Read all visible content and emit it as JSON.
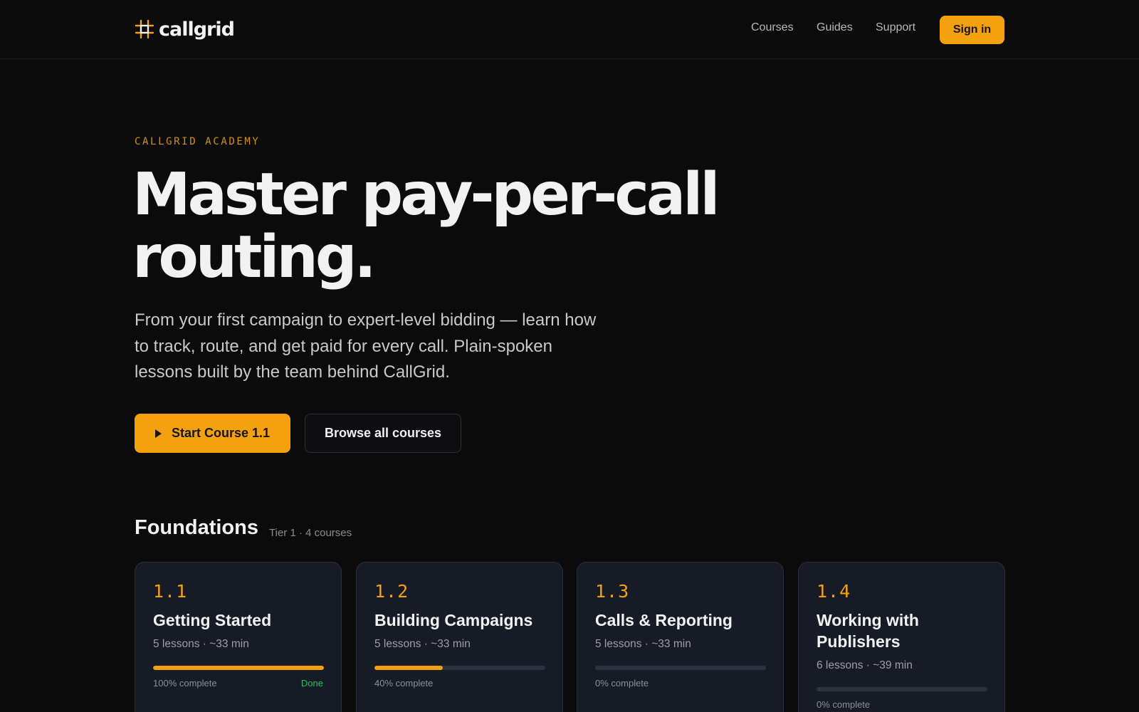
{
  "brand": {
    "name": "callgrid"
  },
  "nav": {
    "courses": "Courses",
    "guides": "Guides",
    "support": "Support",
    "signin": "Sign in"
  },
  "hero": {
    "eyebrow": "CALLGRID ACADEMY",
    "headline_line1": "Master pay-per-call",
    "headline_line2": "routing.",
    "lede": "From your first campaign to expert-level bidding — learn how to track, route, and get paid for every call. Plain-spoken lessons built by the team behind CallGrid.",
    "primary_cta": "Start Course 1.1",
    "secondary_cta": "Browse all courses"
  },
  "section": {
    "title": "Foundations",
    "meta": "Tier 1 · 4 courses"
  },
  "courses": [
    {
      "num": "1.1",
      "title": "Getting Started",
      "meta": "5 lessons · ~33 min",
      "progress": 1.0,
      "progress_label": "100% complete",
      "status": "Done"
    },
    {
      "num": "1.2",
      "title": "Building Campaigns",
      "meta": "5 lessons · ~33 min",
      "progress": 0.4,
      "progress_label": "40% complete",
      "status": ""
    },
    {
      "num": "1.3",
      "title": "Calls & Reporting",
      "meta": "5 lessons · ~33 min",
      "progress": 0.0,
      "progress_label": "0% complete",
      "status": ""
    },
    {
      "num": "1.4",
      "title": "Working with Publishers",
      "meta": "6 lessons · ~39 min",
      "progress": 0.0,
      "progress_label": "0% complete",
      "status": ""
    }
  ],
  "colors": {
    "accent": "#f5a00f",
    "background": "#0b0b0c",
    "card": "#161b26",
    "done": "#22c55e"
  }
}
